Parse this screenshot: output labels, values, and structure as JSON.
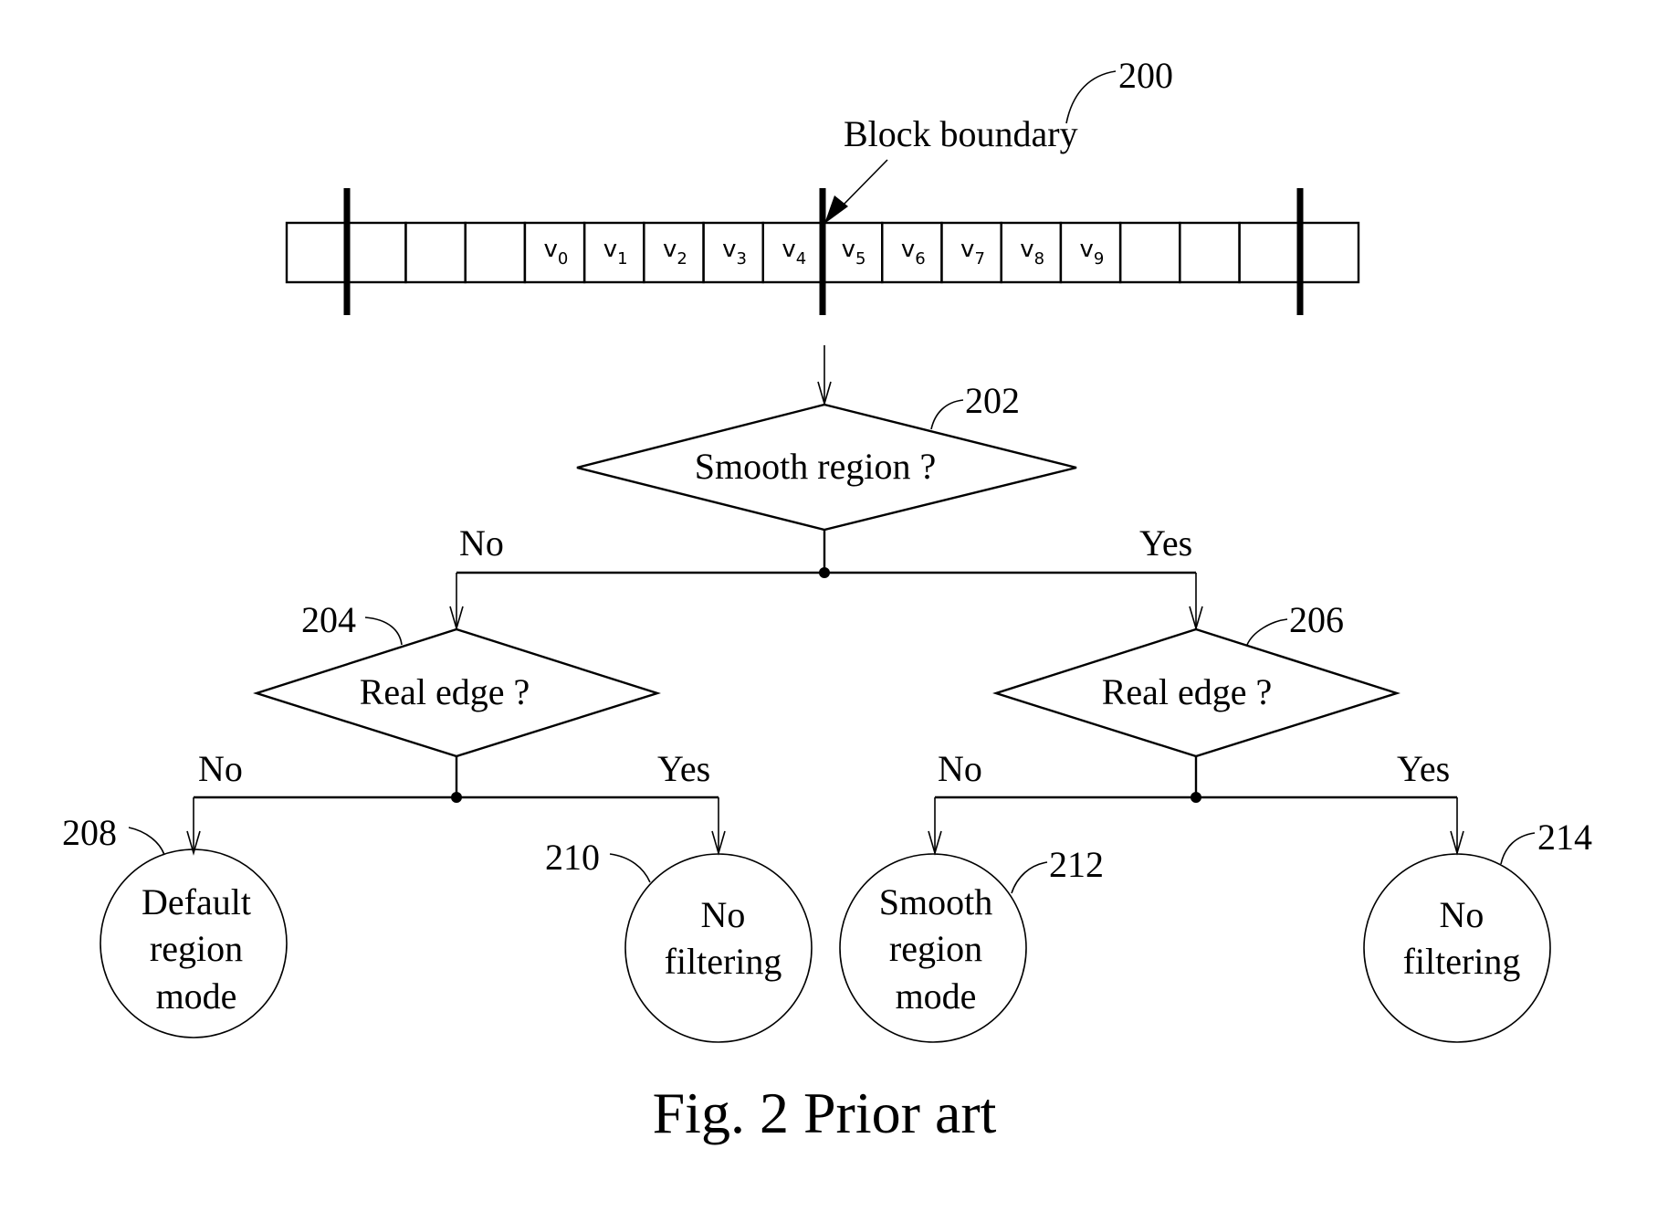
{
  "figure": {
    "caption": "Fig. 2 Prior art",
    "reference": "200",
    "block_boundary_label": "Block boundary"
  },
  "pixel_strip": {
    "cell_count": 18,
    "cells": [
      {
        "label": "",
        "sub": ""
      },
      {
        "label": "",
        "sub": ""
      },
      {
        "label": "",
        "sub": ""
      },
      {
        "label": "",
        "sub": ""
      },
      {
        "label": "v",
        "sub": "0"
      },
      {
        "label": "v",
        "sub": "1"
      },
      {
        "label": "v",
        "sub": "2"
      },
      {
        "label": "v",
        "sub": "3"
      },
      {
        "label": "v",
        "sub": "4"
      },
      {
        "label": "v",
        "sub": "5"
      },
      {
        "label": "v",
        "sub": "6"
      },
      {
        "label": "v",
        "sub": "7"
      },
      {
        "label": "v",
        "sub": "8"
      },
      {
        "label": "v",
        "sub": "9"
      },
      {
        "label": "",
        "sub": ""
      },
      {
        "label": "",
        "sub": ""
      },
      {
        "label": "",
        "sub": ""
      },
      {
        "label": "",
        "sub": ""
      }
    ]
  },
  "nodes": {
    "d202": {
      "ref": "202",
      "text": "Smooth region ?"
    },
    "d204": {
      "ref": "204",
      "text": "Real edge ?"
    },
    "d206": {
      "ref": "206",
      "text": "Real edge ?"
    },
    "c208": {
      "ref": "208",
      "lines": [
        "Default",
        "region",
        "mode"
      ]
    },
    "c210": {
      "ref": "210",
      "lines": [
        "No",
        "filtering"
      ]
    },
    "c212": {
      "ref": "212",
      "lines": [
        "Smooth",
        "region",
        "mode"
      ]
    },
    "c214": {
      "ref": "214",
      "lines": [
        "No",
        "filtering"
      ]
    }
  },
  "branches": {
    "d202_no": "No",
    "d202_yes": "Yes",
    "d204_no": "No",
    "d204_yes": "Yes",
    "d206_no": "No",
    "d206_yes": "Yes"
  }
}
